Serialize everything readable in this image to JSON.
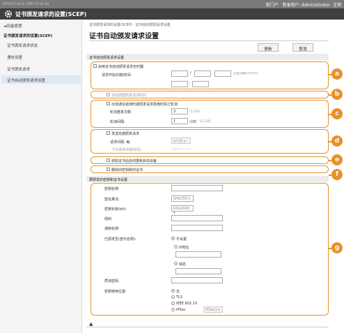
{
  "topbar": {
    "left_text": "[IPV-C3 v1.0 / IPV-C3 v1.0]",
    "portal": "到门户",
    "login_user": "登录用户: Administrator",
    "logout": "注销"
  },
  "header": {
    "title": "证书颁发请求的设置(SCEP)"
  },
  "sidebar": {
    "back": "◄设备管理",
    "section": "证书颁发请求的设置(SCEP)",
    "items": [
      "证书颁发请求状态",
      "通信设置",
      "证书颁发请求",
      "证书自动颁发请求设置"
    ]
  },
  "breadcrumb": "证书颁发请求的设置(SCEP) : 证书自动颁发请求设置",
  "page_title": "证书自动颁发请求设置",
  "buttons": {
    "update": "更新",
    "cancel": "取消"
  },
  "section1": {
    "title": "证书自动颁发请求设置"
  },
  "group_a": {
    "checkbox": "启用证书自动颁发请求定时器",
    "label": "请求开始日期/时间:",
    "slash": "/",
    "format": "(DD/MM YYYY)",
    "colon": ":"
  },
  "group_b": {
    "checkbox": "自动调整颁发请求时间"
  },
  "group_c": {
    "checkbox": "出现通信错误时或颁发请求拒绝时执行轮询",
    "retry_label": "轮询重复次数:",
    "retry_value": "3",
    "retry_range": "(1-10)",
    "interval_label": "轮询间隔:",
    "interval_value": "1",
    "interval_unit": "小时",
    "interval_range": "(1-24)"
  },
  "group_d": {
    "checkbox": "发送定期颁发请求",
    "period_label": "请求间隔: 每:",
    "period_value": "6个月",
    "next_label": "下次请求日期/时间:",
    "next_value": "--/--/---- --:--"
  },
  "group_e": {
    "checkbox": "获取证书后自动重新启动设备"
  },
  "group_f": {
    "checkbox": "删除旧密钥和旧证书"
  },
  "section2": {
    "title": "要颁发的密钥和证书设置"
  },
  "group_g": {
    "key_name_label": "密钥名称:",
    "sig_label": "签名算法:",
    "sig_value": "SHA256",
    "keylen_label": "密钥长度(bit):",
    "keylen_value": "RSA2048",
    "org_label": "组织:",
    "cn_label": "通用名称:",
    "san_label": "已颁发至(替代名称):",
    "san_opt_none": "不设置",
    "san_opt_ip": "IP地址",
    "san_opt_domain": "域名",
    "challenge_label": "质询密码:",
    "usage_label": "密钥使用位置:",
    "usage_none": "无",
    "usage_tls": "TLS",
    "usage_ieee": "IEEE 802.1X",
    "usage_ipsec": "IPSec",
    "ipsec_value": "IPSec1"
  },
  "footer_icon": "top-arrow-icon",
  "callouts": [
    "a",
    "b",
    "c",
    "d",
    "e",
    "f",
    "g"
  ],
  "accent_color": "#e8912a"
}
